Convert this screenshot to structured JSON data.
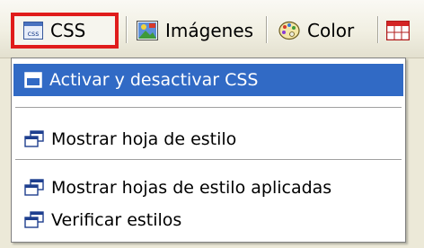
{
  "toolbar": {
    "css_label": "CSS",
    "css_icon_text": "css",
    "images_label": "Imágenes",
    "color_label": "Color"
  },
  "menu": {
    "items": [
      {
        "label": "Activar y desactivar CSS",
        "icon": "window-icon",
        "selected": true
      },
      {
        "label": "Mostrar hoja de estilo",
        "icon": "cascade-windows-icon",
        "selected": false
      },
      {
        "label": "Mostrar hojas de estilo aplicadas",
        "icon": "cascade-windows-icon",
        "selected": false
      },
      {
        "label": "Verificar estilos",
        "icon": "cascade-windows-icon",
        "selected": false
      }
    ]
  },
  "colors": {
    "highlight": "#316ac5",
    "css_button_outline": "#e01c1c",
    "toolbar_background": "#f1efe2"
  }
}
